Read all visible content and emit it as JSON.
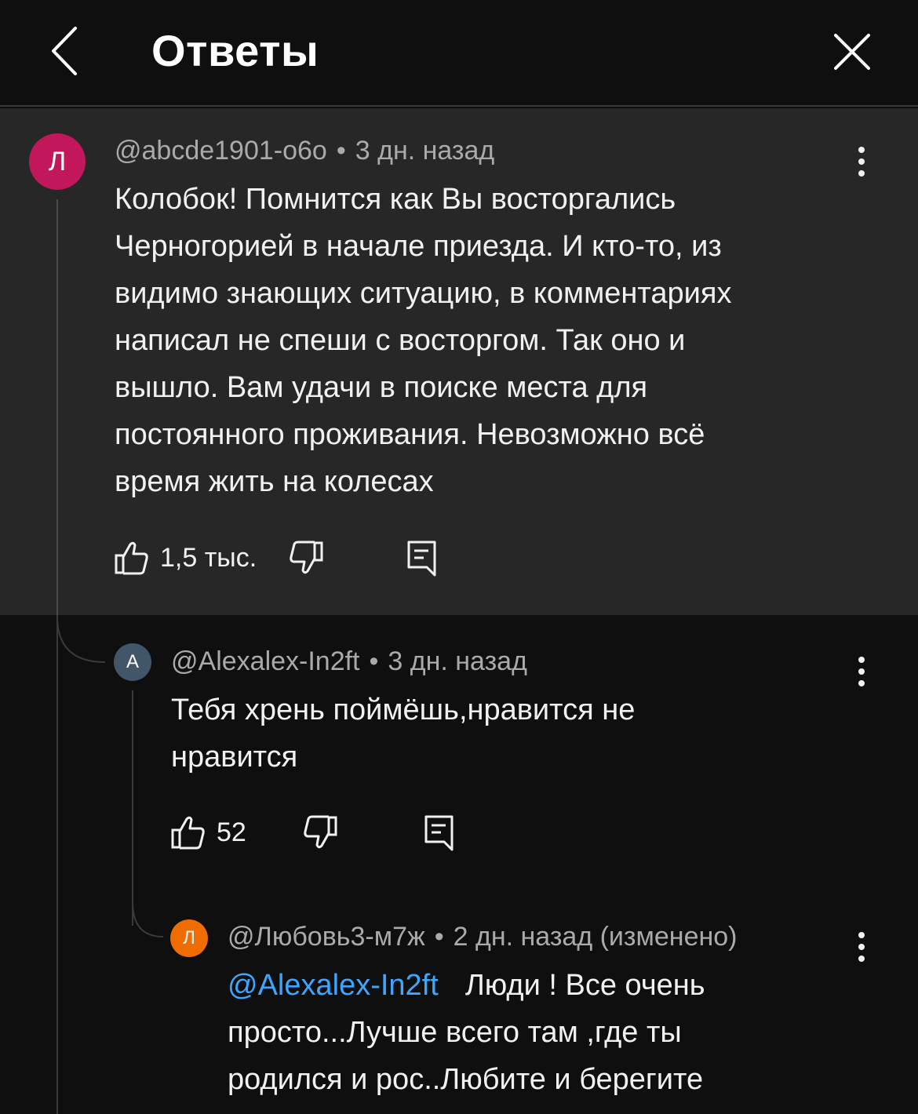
{
  "header": {
    "title": "Ответы",
    "back_icon": "chevron-left-icon",
    "close_icon": "close-icon"
  },
  "parent_comment": {
    "avatar_letter": "Л",
    "avatar_color": "#c2185b",
    "author": "@abcde1901-o6o",
    "time": "3 дн. назад",
    "text_lines": [
      "Колобок! Помнится как Вы восторгались",
      "Черногорией в начале приезда. И кто-то, из",
      "видимо знающих ситуацию, в комментариях",
      "написал не спеши с восторгом. Так оно и",
      "вышло. Вам удачи в поиске места для",
      "постоянного проживания. Невозможно всё",
      "время жить на колесах"
    ],
    "likes": "1,5 тыс."
  },
  "reply_1": {
    "avatar_letter": "A",
    "avatar_color": "#42566a",
    "author": "@Alexalex-In2ft",
    "time": "3 дн. назад",
    "text_lines": [
      "Тебя хрень поймёшь,нравится не",
      "нравится"
    ],
    "likes": "52"
  },
  "reply_2": {
    "avatar_letter": "Л",
    "avatar_color": "#ef6c00",
    "author": "@Любовь3-м7ж",
    "time": "2 дн. назад (изменено)",
    "mention": "@Alexalex-In2ft",
    "text_line_1_rest": "Люди ! Все очень",
    "text_lines": [
      "просто...Лучше всего там ,где ты",
      "родился и рос..Любите и берегите"
    ]
  },
  "separator": "•"
}
